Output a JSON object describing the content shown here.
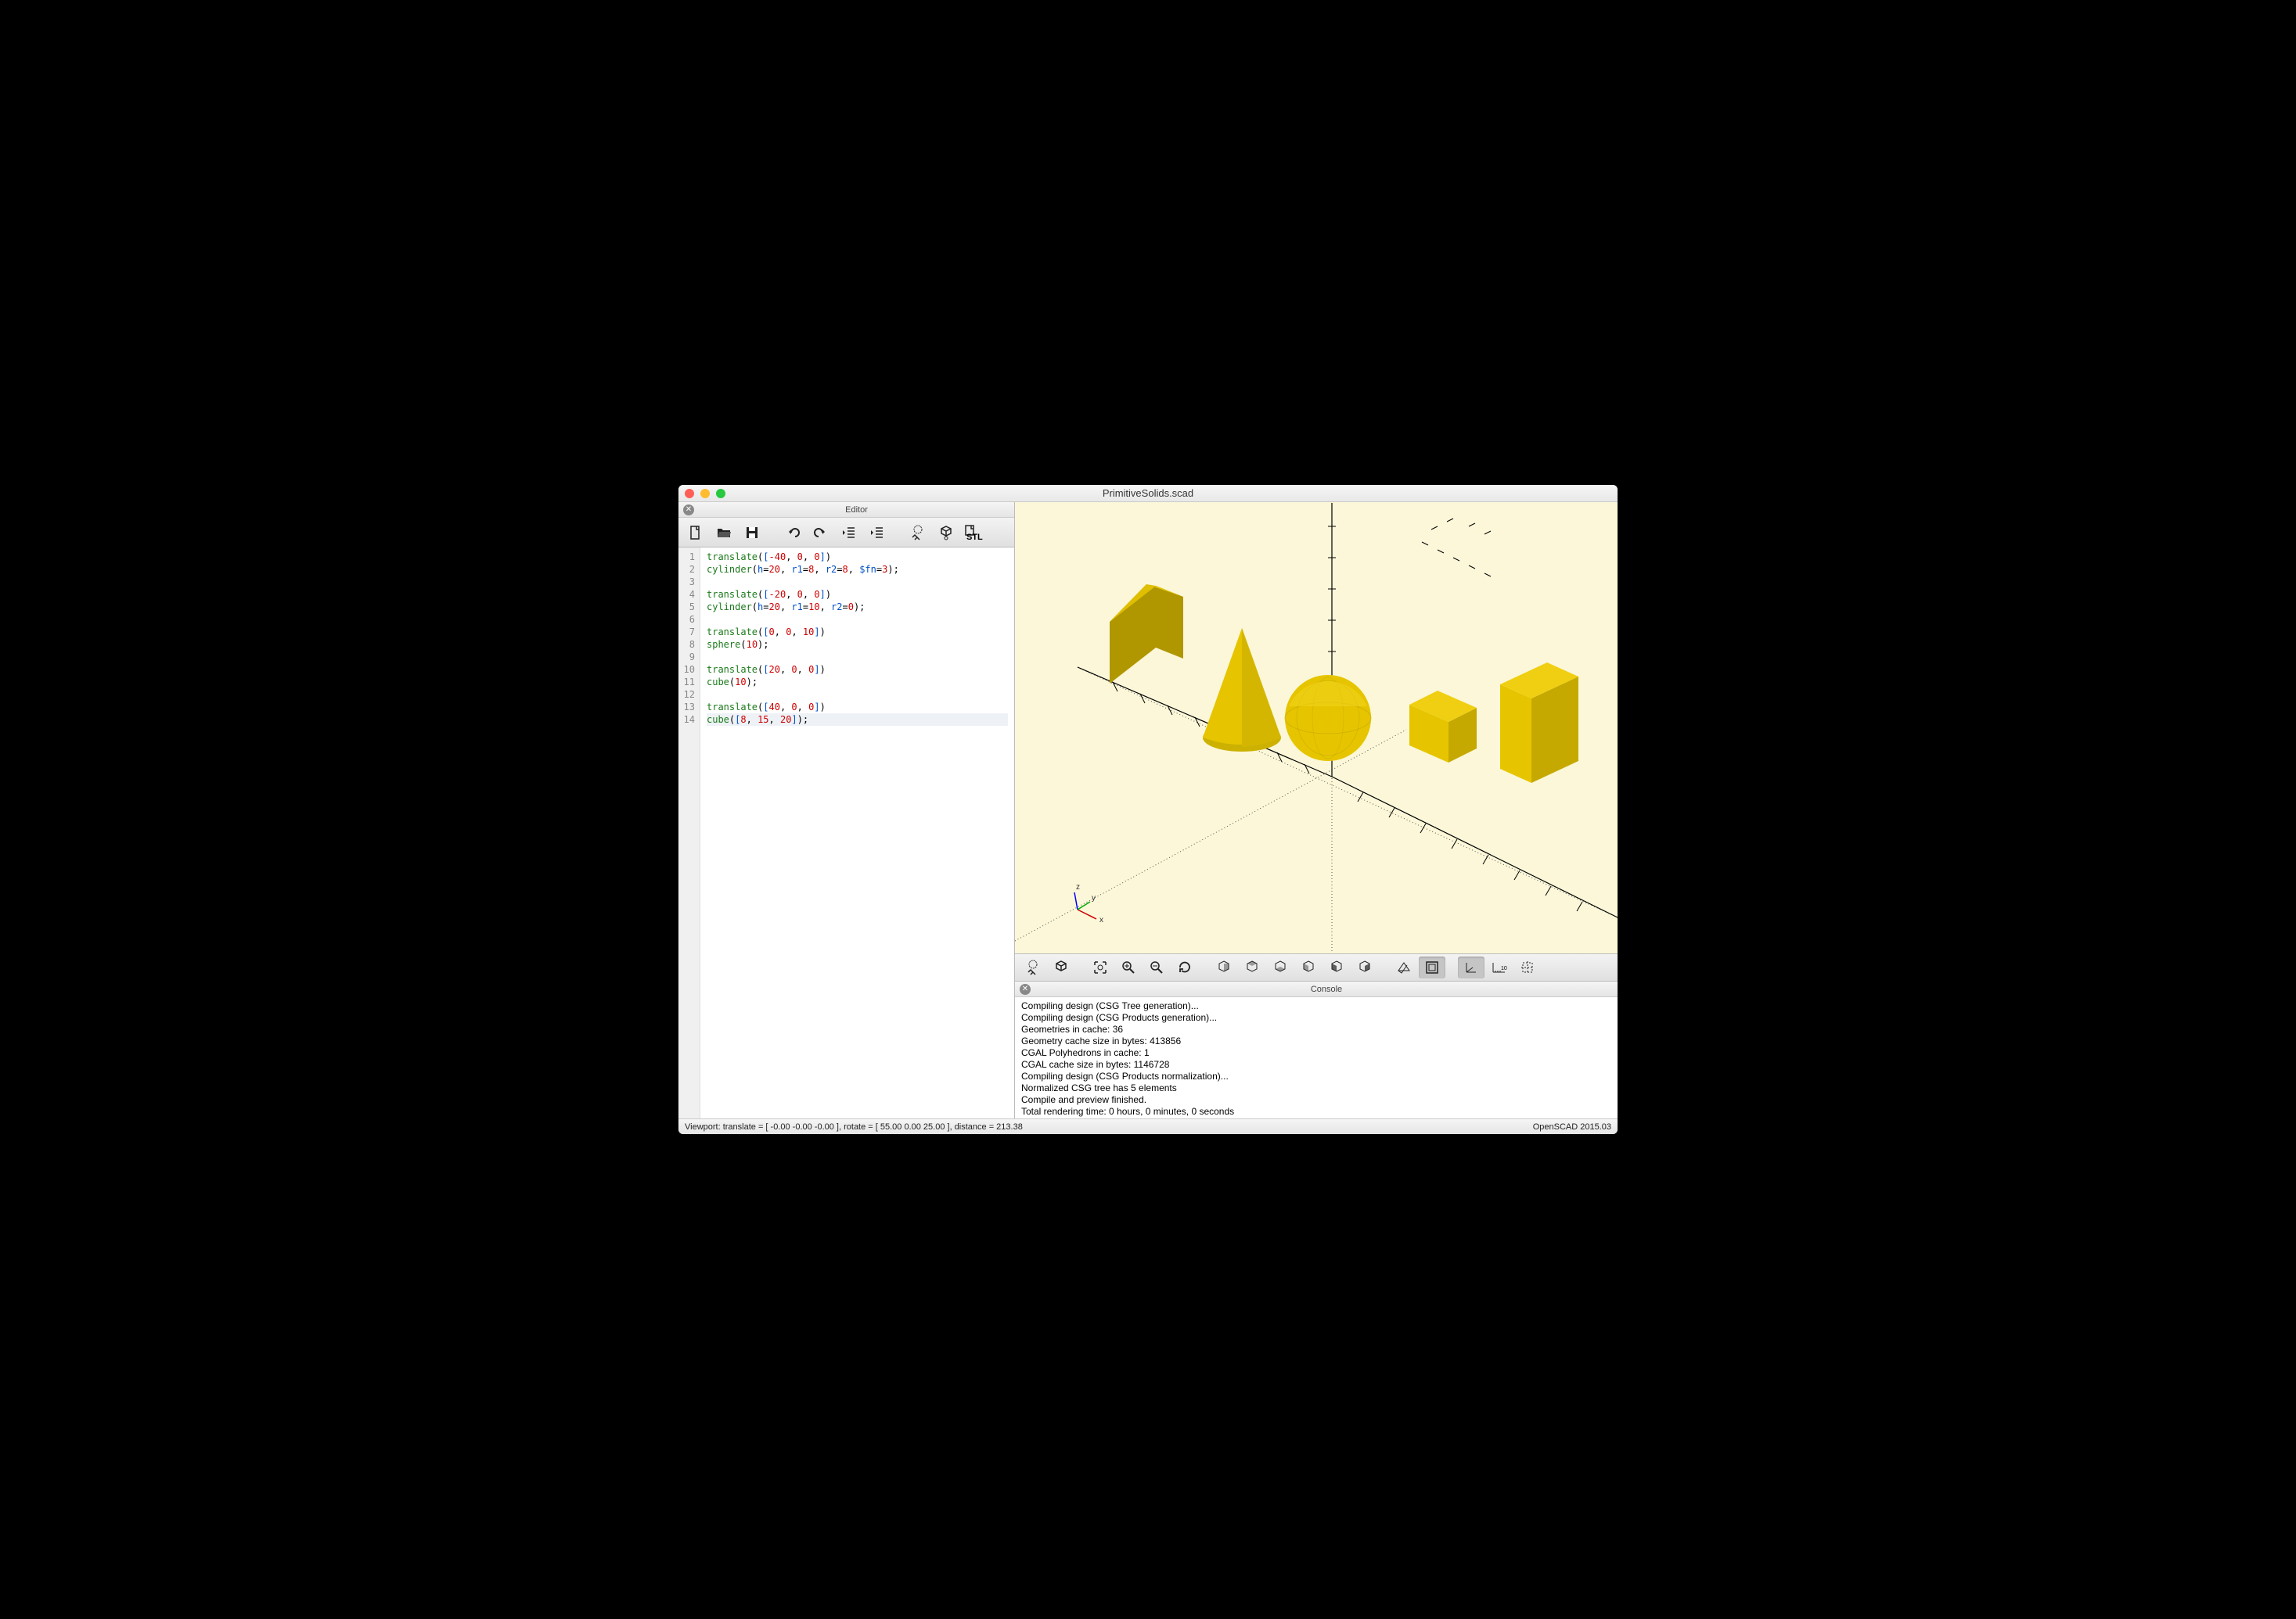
{
  "window": {
    "title": "PrimitiveSolids.scad"
  },
  "editor_panel": {
    "title": "Editor"
  },
  "toolbar": {
    "new": "new-file",
    "open": "open-file",
    "save": "save-file",
    "undo": "undo",
    "redo": "redo",
    "unindent": "unindent",
    "indent": "indent",
    "preview": "preview",
    "render": "render",
    "stl": "STL"
  },
  "code_lines": [
    {
      "n": 1,
      "html": "<span class='kw'>translate</span><span class='sym'>(</span><span class='br'>[</span><span class='num'>-40</span><span class='sym'>,</span> <span class='num'>0</span><span class='sym'>,</span> <span class='num'>0</span><span class='br'>]</span><span class='sym'>)</span>"
    },
    {
      "n": 2,
      "html": "<span class='kw'>cylinder</span><span class='sym'>(</span><span class='param'>h</span><span class='sym'>=</span><span class='num'>20</span><span class='sym'>,</span> <span class='param'>r1</span><span class='sym'>=</span><span class='num'>8</span><span class='sym'>,</span> <span class='param'>r2</span><span class='sym'>=</span><span class='num'>8</span><span class='sym'>,</span> <span class='param'>$fn</span><span class='sym'>=</span><span class='num'>3</span><span class='sym'>);</span>"
    },
    {
      "n": 3,
      "html": ""
    },
    {
      "n": 4,
      "html": "<span class='kw'>translate</span><span class='sym'>(</span><span class='br'>[</span><span class='num'>-20</span><span class='sym'>,</span> <span class='num'>0</span><span class='sym'>,</span> <span class='num'>0</span><span class='br'>]</span><span class='sym'>)</span>"
    },
    {
      "n": 5,
      "html": "<span class='kw'>cylinder</span><span class='sym'>(</span><span class='param'>h</span><span class='sym'>=</span><span class='num'>20</span><span class='sym'>,</span> <span class='param'>r1</span><span class='sym'>=</span><span class='num'>10</span><span class='sym'>,</span> <span class='param'>r2</span><span class='sym'>=</span><span class='num'>0</span><span class='sym'>);</span>"
    },
    {
      "n": 6,
      "html": ""
    },
    {
      "n": 7,
      "html": "<span class='kw'>translate</span><span class='sym'>(</span><span class='br'>[</span><span class='num'>0</span><span class='sym'>,</span> <span class='num'>0</span><span class='sym'>,</span> <span class='num'>10</span><span class='br'>]</span><span class='sym'>)</span>"
    },
    {
      "n": 8,
      "html": "<span class='kw'>sphere</span><span class='sym'>(</span><span class='num'>10</span><span class='sym'>);</span>"
    },
    {
      "n": 9,
      "html": ""
    },
    {
      "n": 10,
      "html": "<span class='kw'>translate</span><span class='sym'>(</span><span class='br'>[</span><span class='num'>20</span><span class='sym'>,</span> <span class='num'>0</span><span class='sym'>,</span> <span class='num'>0</span><span class='br'>]</span><span class='sym'>)</span>"
    },
    {
      "n": 11,
      "html": "<span class='kw'>cube</span><span class='sym'>(</span><span class='num'>10</span><span class='sym'>);</span>"
    },
    {
      "n": 12,
      "html": ""
    },
    {
      "n": 13,
      "html": "<span class='kw'>translate</span><span class='sym'>(</span><span class='br'>[</span><span class='num'>40</span><span class='sym'>,</span> <span class='num'>0</span><span class='sym'>,</span> <span class='num'>0</span><span class='br'>]</span><span class='sym'>)</span>"
    },
    {
      "n": 14,
      "html": "<span class='kw'>cube</span><span class='sym'>(</span><span class='br'>[</span><span class='num'>8</span><span class='sym'>,</span> <span class='num'>15</span><span class='sym'>,</span> <span class='num'>20</span><span class='br'>]</span><span class='sym'>);</span>",
      "hl": true
    }
  ],
  "axis_labels": {
    "x": "x",
    "y": "y",
    "z": "z"
  },
  "view_toolbar": {
    "preview": "preview",
    "render": "render",
    "view_all": "view-all",
    "zoom_in": "zoom-in",
    "zoom_out": "zoom-out",
    "reset_view": "reset-view",
    "right": "view-right",
    "top": "view-top",
    "bottom": "view-bottom",
    "left": "view-left",
    "front": "view-front",
    "back": "view-back",
    "diagonal": "view-diagonal",
    "perspective": "perspective",
    "axes": "show-axes",
    "scale": "show-scale",
    "crosshair": "show-crosshairs"
  },
  "console_panel": {
    "title": "Console"
  },
  "console_lines": [
    "Compiling design (CSG Tree generation)...",
    "Compiling design (CSG Products generation)...",
    "Geometries in cache: 36",
    "Geometry cache size in bytes: 413856",
    "CGAL Polyhedrons in cache: 1",
    "CGAL cache size in bytes: 1146728",
    "Compiling design (CSG Products normalization)...",
    "Normalized CSG tree has 5 elements",
    "Compile and preview finished.",
    "Total rendering time: 0 hours, 0 minutes, 0 seconds"
  ],
  "status": {
    "left": "Viewport: translate = [ -0.00 -0.00 -0.00 ], rotate = [ 55.00 0.00 25.00 ], distance = 213.38",
    "right": "OpenSCAD 2015.03"
  }
}
